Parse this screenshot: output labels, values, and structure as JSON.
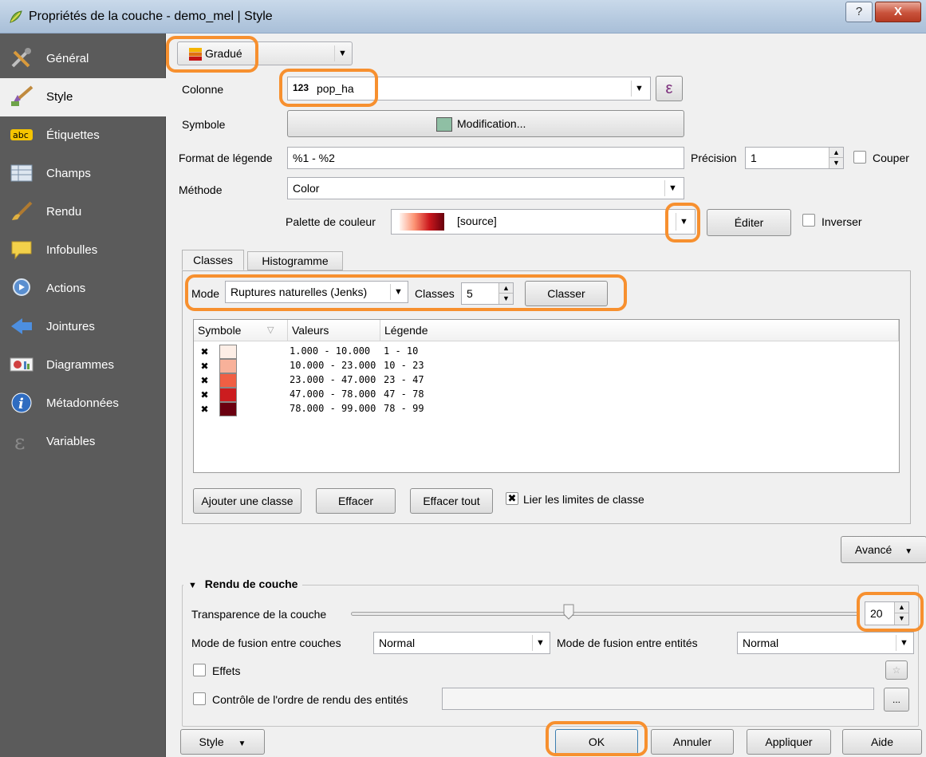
{
  "window": {
    "title": "Propriétés de la couche - demo_mel | Style",
    "help_btn": "?",
    "close_btn": "X"
  },
  "sidebar": {
    "items": [
      {
        "label": "Général",
        "icon": "general-tools-icon"
      },
      {
        "label": "Style",
        "icon": "style-brush-icon"
      },
      {
        "label": "Étiquettes",
        "icon": "labels-abc-icon"
      },
      {
        "label": "Champs",
        "icon": "fields-table-icon"
      },
      {
        "label": "Rendu",
        "icon": "rendering-brush-icon"
      },
      {
        "label": "Infobulles",
        "icon": "tooltip-bubble-icon"
      },
      {
        "label": "Actions",
        "icon": "actions-gear-icon"
      },
      {
        "label": "Jointures",
        "icon": "joins-arrow-icon"
      },
      {
        "label": "Diagrammes",
        "icon": "diagrams-icon"
      },
      {
        "label": "Métadonnées",
        "icon": "info-icon"
      },
      {
        "label": "Variables",
        "icon": "variables-epsilon-icon"
      }
    ],
    "active_index": 1
  },
  "renderer": {
    "value": "Gradué"
  },
  "column": {
    "label": "Colonne",
    "type_badge": "123",
    "value": "pop_ha",
    "expr_btn": "ε"
  },
  "symbol": {
    "label": "Symbole",
    "button": "Modification...",
    "color": "#8fbfa4"
  },
  "legend_format": {
    "label": "Format de légende",
    "value": "%1 - %2",
    "precision_label": "Précision",
    "precision_value": "1",
    "trim_label": "Couper"
  },
  "method": {
    "label": "Méthode",
    "value": "Color"
  },
  "palette": {
    "label": "Palette de couleur",
    "value": "[source]",
    "edit_btn": "Éditer",
    "invert_label": "Inverser"
  },
  "tabs": {
    "classes": "Classes",
    "histogram": "Histogramme"
  },
  "mode": {
    "label": "Mode",
    "value": "Ruptures naturelles (Jenks)",
    "classes_label": "Classes",
    "classes_value": "5",
    "classify_btn": "Classer"
  },
  "table": {
    "headers": {
      "symbol": "Symbole",
      "values": "Valeurs",
      "legend": "Légende"
    },
    "rows": [
      {
        "check": "✖",
        "color": "#fdeee6",
        "values": "1.000 - 10.000",
        "legend": "1 - 10"
      },
      {
        "check": "✖",
        "color": "#f8b19a",
        "values": "10.000 - 23.000",
        "legend": "10 - 23"
      },
      {
        "check": "✖",
        "color": "#f05f44",
        "values": "23.000 - 47.000",
        "legend": "23 - 47"
      },
      {
        "check": "✖",
        "color": "#cc1c1f",
        "values": "47.000 - 78.000",
        "legend": "47 - 78"
      },
      {
        "check": "✖",
        "color": "#6b0010",
        "values": "78.000 - 99.000",
        "legend": "78 - 99"
      }
    ]
  },
  "class_buttons": {
    "add": "Ajouter une classe",
    "delete": "Effacer",
    "delete_all": "Effacer tout",
    "link_label": "Lier les limites de classe",
    "link_check": "✖"
  },
  "advanced_btn": "Avancé",
  "layer_rendering": {
    "title": "Rendu de couche",
    "transparency_label": "Transparence de la couche",
    "transparency_value": "20",
    "transparency_fraction": 0.43,
    "layer_blend_label": "Mode de fusion entre couches",
    "layer_blend_value": "Normal",
    "feature_blend_label": "Mode de fusion entre entités",
    "feature_blend_value": "Normal",
    "effects_label": "Effets",
    "order_label": "Contrôle de l'ordre de rendu des entités",
    "order_btn": "..."
  },
  "footer": {
    "style_btn": "Style",
    "ok": "OK",
    "cancel": "Annuler",
    "apply": "Appliquer",
    "help": "Aide"
  },
  "colors": {
    "highlight": "#f7902f",
    "sidebar_bg": "#5b5b5b"
  }
}
